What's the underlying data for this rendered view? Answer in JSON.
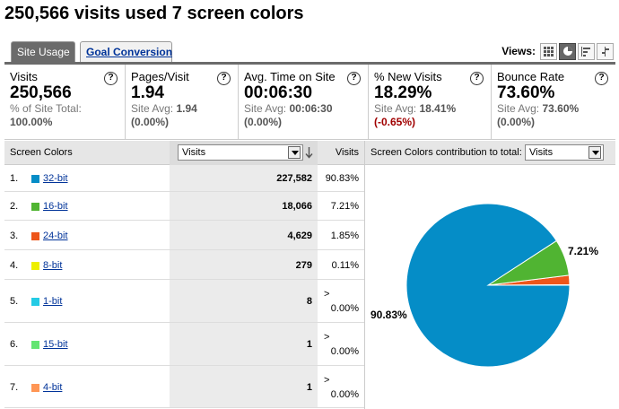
{
  "title": "250,566 visits used 7 screen colors",
  "tabs": {
    "site_usage": "Site Usage",
    "goal_conversion": "Goal Conversion"
  },
  "views_label": "Views:",
  "metrics": [
    {
      "label": "Visits",
      "value": "250,566",
      "sub1": "% of Site Total:",
      "sub2": "100.00%"
    },
    {
      "label": "Pages/Visit",
      "value": "1.94",
      "sub1": "Site Avg: ",
      "sub1b": "1.94",
      "sub2": "(0.00%)"
    },
    {
      "label": "Avg. Time on Site",
      "value": "00:06:30",
      "sub1": "Site Avg: ",
      "sub1b": "00:06:30",
      "sub2": "(0.00%)"
    },
    {
      "label": "% New Visits",
      "value": "18.29%",
      "sub1": "Site Avg: ",
      "sub1b": "18.41%",
      "sub2": "(-0.65%)"
    },
    {
      "label": "Bounce Rate",
      "value": "73.60%",
      "sub1": "Site Avg: ",
      "sub1b": "73.60%",
      "sub2": "(0.00%)"
    }
  ],
  "grid": {
    "col_dimension": "Screen Colors",
    "col_metric_select": "Visits",
    "col_visits": "Visits",
    "contribution_label": "Screen Colors contribution to total:",
    "contribution_select": "Visits",
    "rows": [
      {
        "num": "1.",
        "label": "32-bit",
        "color": "#058dc7",
        "visits": "227,582",
        "pct": "90.83%"
      },
      {
        "num": "2.",
        "label": "16-bit",
        "color": "#50b432",
        "visits": "18,066",
        "pct": "7.21%"
      },
      {
        "num": "3.",
        "label": "24-bit",
        "color": "#ed561b",
        "visits": "4,629",
        "pct": "1.85%"
      },
      {
        "num": "4.",
        "label": "8-bit",
        "color": "#edef00",
        "visits": "279",
        "pct": "0.11%"
      },
      {
        "num": "5.",
        "label": "1-bit",
        "color": "#24cbe5",
        "visits": "8",
        "pct_prefix": ">",
        "pct": "0.00%"
      },
      {
        "num": "6.",
        "label": "15-bit",
        "color": "#64e572",
        "visits": "1",
        "pct_prefix": ">",
        "pct": "0.00%"
      },
      {
        "num": "7.",
        "label": "4-bit",
        "color": "#ff9655",
        "visits": "1",
        "pct_prefix": ">",
        "pct": "0.00%"
      }
    ]
  },
  "help_glyph": "?",
  "chart_data": {
    "type": "pie",
    "categories": [
      "32-bit",
      "16-bit",
      "24-bit",
      "8-bit",
      "1-bit",
      "15-bit",
      "4-bit"
    ],
    "values": [
      90.83,
      7.21,
      1.85,
      0.11,
      0.0,
      0.0,
      0.0
    ],
    "colors": [
      "#058dc7",
      "#50b432",
      "#ed561b",
      "#edef00",
      "#24cbe5",
      "#64e572",
      "#ff9655"
    ],
    "labels": {
      "major": "90.83%",
      "second": "7.21%"
    }
  }
}
